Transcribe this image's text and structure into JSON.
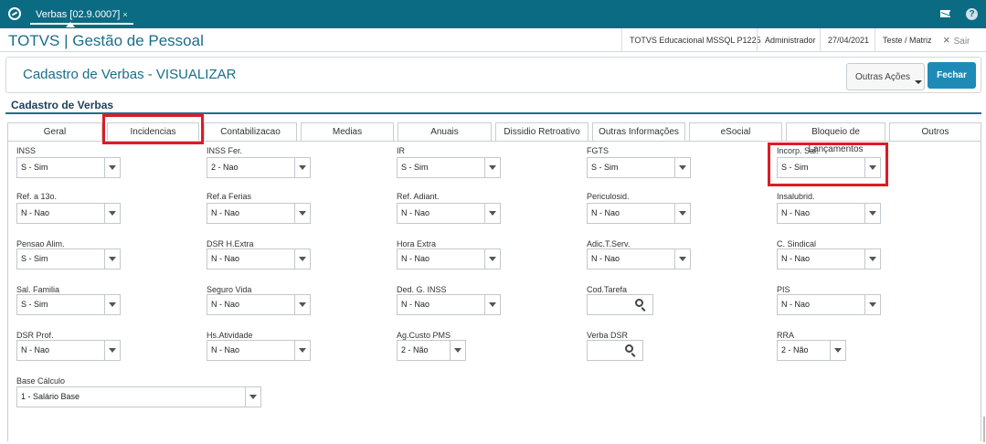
{
  "topbar": {
    "tab_label": "Verbas [02.9.0007]",
    "tab_close": "×",
    "icons": [
      "totvs-logo-icon",
      "mail-icon",
      "help-icon"
    ]
  },
  "header": {
    "app_title": "TOTVS | Gestão de Pessoal",
    "environment": "TOTVS Educacional MSSQL P1225",
    "user": "Administrador",
    "date": "27/04/2021",
    "company": "Teste / Matriz",
    "exit_label": "Sair",
    "exit_icon": "×"
  },
  "page": {
    "title": "Cadastro de Verbas - VISUALIZAR",
    "outras_acoes": "Outras Ações",
    "fechar": "Fechar",
    "section_title": "Cadastro de Verbas"
  },
  "tabs": [
    {
      "label": "Geral"
    },
    {
      "label": "Incidencias"
    },
    {
      "label": "Contabilizacao"
    },
    {
      "label": "Medias"
    },
    {
      "label": "Anuais"
    },
    {
      "label": "Dissidio Retroativo"
    },
    {
      "label": "Outras Informações"
    },
    {
      "label": "eSocial"
    },
    {
      "label": "Bloqueio de Lançamentos"
    },
    {
      "label": "Outros"
    }
  ],
  "fields": {
    "inss": {
      "label": "INSS",
      "value": "S - Sim"
    },
    "inss_fer": {
      "label": "INSS Fer.",
      "value": "2 - Nao"
    },
    "ir": {
      "label": "IR",
      "value": "S - Sim"
    },
    "fgts": {
      "label": "FGTS",
      "value": "S - Sim"
    },
    "incorp_sal": {
      "label": "Incorp. Sal.",
      "value": "S - Sim"
    },
    "ref_13o": {
      "label": "Ref. a 13o.",
      "value": "N - Nao"
    },
    "ref_ferias": {
      "label": "Ref.a Ferias",
      "value": "N - Nao"
    },
    "ref_adiant": {
      "label": "Ref. Adiant.",
      "value": "N - Nao"
    },
    "periculosid": {
      "label": "Periculosid.",
      "value": "N - Nao"
    },
    "insalubrid": {
      "label": "Insalubrid.",
      "value": "N - Nao"
    },
    "pensao_alim": {
      "label": "Pensao Alim.",
      "value": "S - Sim"
    },
    "dsr_h_extra": {
      "label": "DSR H.Extra",
      "value": "N - Nao"
    },
    "hora_extra": {
      "label": "Hora Extra",
      "value": "N - Nao"
    },
    "adic_t_serv": {
      "label": "Adic.T.Serv.",
      "value": "N - Nao"
    },
    "c_sindical": {
      "label": "C. Sindical",
      "value": "N - Nao"
    },
    "sal_familia": {
      "label": "Sal. Familia",
      "value": "S - Sim"
    },
    "seguro_vida": {
      "label": "Seguro Vida",
      "value": "N - Nao"
    },
    "ded_g_inss": {
      "label": "Ded. G. INSS",
      "value": "N - Nao"
    },
    "cod_tarefa": {
      "label": "Cod.Tarefa",
      "value": ""
    },
    "pis": {
      "label": "PIS",
      "value": "N - Nao"
    },
    "dsr_prof": {
      "label": "DSR Prof.",
      "value": "N - Nao"
    },
    "hs_atividade": {
      "label": "Hs.Atividade",
      "value": "N - Nao"
    },
    "ag_custo_pms": {
      "label": "Ag.Custo PMS",
      "value": "2 - Não"
    },
    "verba_dsr": {
      "label": "Verba DSR",
      "value": ""
    },
    "rra": {
      "label": "RRA",
      "value": "2 - Não"
    },
    "base_calculo": {
      "label": "Base Cálculo",
      "value": "1 - Salário Base"
    }
  },
  "colors": {
    "topbar": "#0b6b83",
    "accent": "#1b6d8a",
    "primary_button": "#1e8bb6",
    "highlight": "#dc1c25"
  }
}
